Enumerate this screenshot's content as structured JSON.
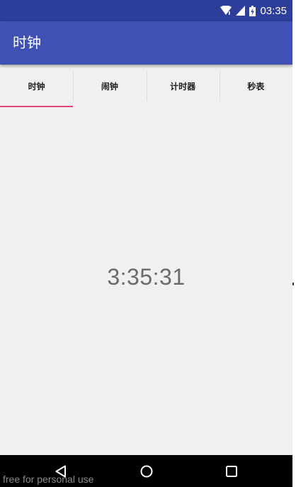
{
  "status_bar": {
    "time": "03:35",
    "icons": [
      "wifi-icon",
      "signal-icon",
      "battery-charging-icon"
    ],
    "background": "#2c3e99"
  },
  "app_bar": {
    "title": "时钟",
    "background": "#3f51b5"
  },
  "tabs": {
    "items": [
      {
        "label": "时钟",
        "selected": true
      },
      {
        "label": "闹钟",
        "selected": false
      },
      {
        "label": "计时器",
        "selected": false
      },
      {
        "label": "秒表",
        "selected": false
      }
    ],
    "indicator_color": "#e2437b"
  },
  "clock": {
    "time": "3:35:31"
  },
  "nav_bar": {
    "buttons": [
      "back-triangle-icon",
      "home-circle-icon",
      "recents-square-icon"
    ]
  },
  "watermark": "free for personal use"
}
